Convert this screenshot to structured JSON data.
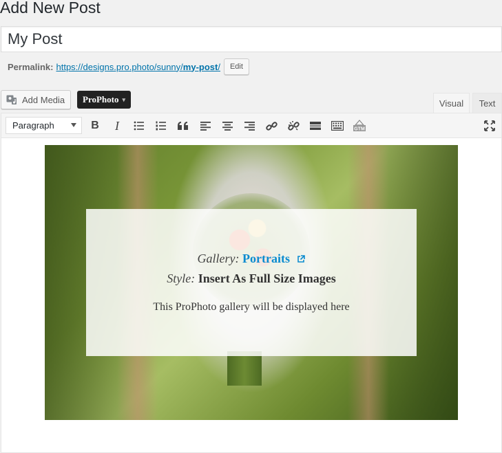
{
  "page": {
    "heading": "Add New Post"
  },
  "post": {
    "title": "My Post"
  },
  "permalink": {
    "label": "Permalink:",
    "url_prefix": "https://designs.pro.photo/sunny/",
    "slug": "my-post",
    "url_suffix": "/",
    "edit_label": "Edit"
  },
  "media_buttons": {
    "add_media_label": "Add Media",
    "prophoto_label": "ProPhoto",
    "prophoto_caret": "▾"
  },
  "editor_tabs": {
    "visual_label": "Visual",
    "text_label": "Text",
    "active": "Visual"
  },
  "toolbar": {
    "format_value": "Paragraph",
    "buttons": [
      "bold",
      "italic",
      "bulleted-list",
      "numbered-list",
      "blockquote",
      "align-left",
      "align-center",
      "align-right",
      "insert-link",
      "remove-link",
      "read-more",
      "toolbar-toggle",
      "gtm",
      "fullscreen"
    ],
    "bold_glyph": "B",
    "italic_glyph": "I",
    "gtm_label": "GTM"
  },
  "gallery_block": {
    "gallery_label": "Gallery:",
    "gallery_name": "Portraits",
    "style_label": "Style:",
    "style_value": "Insert As Full Size Images",
    "note": "This ProPhoto gallery will be displayed here"
  },
  "colors": {
    "link": "#0073aa",
    "gallery_link": "#0a8bd0",
    "prophoto_button": "#222222"
  }
}
